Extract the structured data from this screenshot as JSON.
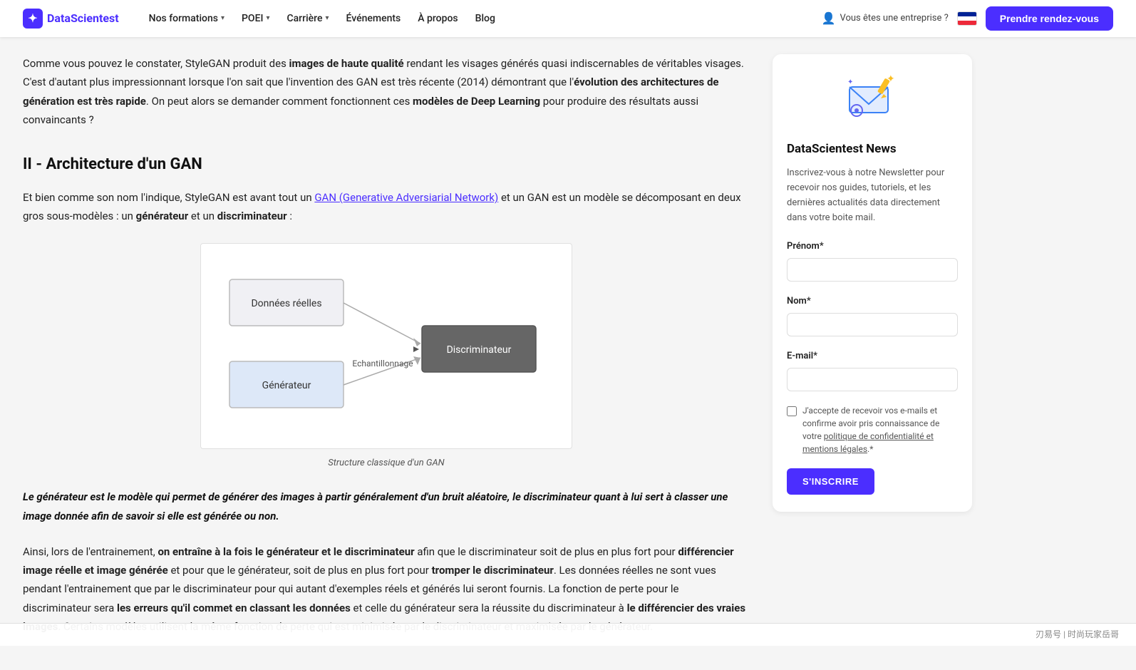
{
  "navbar": {
    "logo_text": "DataScientest",
    "logo_icon": "✦",
    "links": [
      {
        "label": "Nos formations",
        "has_dropdown": true
      },
      {
        "label": "POEI",
        "has_dropdown": true
      },
      {
        "label": "Carrière",
        "has_dropdown": true
      },
      {
        "label": "Événements",
        "has_dropdown": false
      },
      {
        "label": "À propos",
        "has_dropdown": false
      },
      {
        "label": "Blog",
        "has_dropdown": false
      }
    ],
    "enterprise_label": "Vous êtes une entreprise ?",
    "cta_label": "Prendre rendez-vous"
  },
  "content": {
    "intro_para": "Comme vous pouvez le constater, StyleGAN produit des ",
    "intro_bold1": "images de haute qualité",
    "intro_mid": " rendant les visages générés quasi indiscernables de véritables visages. C'est d'autant plus impressionnant lorsque l'on sait que l'invention des GAN est très récente (2014) démontrant que l'",
    "intro_bold2": "évolution des architectures de génération est très rapide",
    "intro_end": ". On peut alors se demander comment fonctionnent ces ",
    "intro_bold3": "modèles de Deep Learning",
    "intro_end2": " pour produire des résultats aussi convaincants ?",
    "section_title": "II - Architecture d'un GAN",
    "section_intro": "Et bien comme son nom l'indique, StyleGAN est avant tout un ",
    "section_link": "GAN (Generative Adversiarial Network)",
    "section_intro2": " et un GAN est un modèle se décomposant en deux gros sous-modèles : un ",
    "section_bold1": "générateur",
    "section_intro3": " et un ",
    "section_bold2": "discriminateur",
    "section_intro4": " :",
    "diagram_caption": "Structure classique d'un GAN",
    "diagram_label_donnees": "Données réelles",
    "diagram_label_generateur": "Générateur",
    "diagram_label_echantillonnage": "Echantillonnage",
    "diagram_label_discriminateur": "Discriminateur",
    "italic_text": "Le générateur est le modèle qui permet de générer des images à partir généralement d'un bruit aléatoire, le discriminateur quant à lui sert à classer une image donnée afin de savoir si elle est générée ou non.",
    "para2_start": "Ainsi, lors de l'entrainement, ",
    "para2_bold1": "on entraîne à la fois le générateur et le discriminateur",
    "para2_mid": " afin que le discriminateur soit de plus en plus fort pour ",
    "para2_bold2": "différencier image réelle et image générée",
    "para2_mid2": " et pour que le générateur, soit de plus en plus fort pour ",
    "para2_bold3": "tromper le discriminateur",
    "para2_end": ". Les données réelles ne sont vues pendant l'entrainement que par le discriminateur pour qui autant d'exemples réels et générés lui seront fournis. La fonction de perte pour le discriminateur sera ",
    "para2_bold4": "les erreurs qu'il commet en classant les données",
    "para2_mid3": " et celle du générateur sera la réussite du discriminateur à ",
    "para2_bold5": "le différencier des vraies images",
    "para2_end2": ". Certains modèles utilisent la même fonction de perte qui est minimisée par le discriminateur et maximisée par le générateur."
  },
  "sidebar": {
    "title": "DataScientest News",
    "description": "Inscrivez-vous à notre Newsletter pour recevoir nos guides, tutoriels, et les dernières actualités data directement dans votre boite mail.",
    "field_prenom": "Prénom",
    "field_prenom_required": "*",
    "field_nom": "Nom",
    "field_nom_required": "*",
    "field_email": "E-mail",
    "field_email_required": "*",
    "checkbox_text": "J'accepte de recevoir vos e-mails et confirme avoir pris connaissance de votre politique de confidentialité et mentions légales.",
    "checkbox_required": "*",
    "subscribe_btn": "S'INSCRIRE"
  },
  "bottom_bar": {
    "text": "刃易号 | 时尚玩家岳哥"
  }
}
